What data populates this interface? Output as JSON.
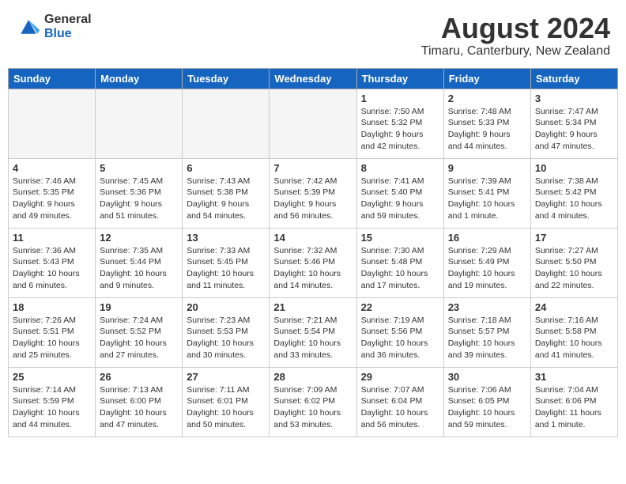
{
  "header": {
    "logo_general": "General",
    "logo_blue": "Blue",
    "title": "August 2024",
    "subtitle": "Timaru, Canterbury, New Zealand"
  },
  "days_of_week": [
    "Sunday",
    "Monday",
    "Tuesday",
    "Wednesday",
    "Thursday",
    "Friday",
    "Saturday"
  ],
  "weeks": [
    [
      {
        "day": "",
        "info": ""
      },
      {
        "day": "",
        "info": ""
      },
      {
        "day": "",
        "info": ""
      },
      {
        "day": "",
        "info": ""
      },
      {
        "day": "1",
        "info": "Sunrise: 7:50 AM\nSunset: 5:32 PM\nDaylight: 9 hours\nand 42 minutes."
      },
      {
        "day": "2",
        "info": "Sunrise: 7:48 AM\nSunset: 5:33 PM\nDaylight: 9 hours\nand 44 minutes."
      },
      {
        "day": "3",
        "info": "Sunrise: 7:47 AM\nSunset: 5:34 PM\nDaylight: 9 hours\nand 47 minutes."
      }
    ],
    [
      {
        "day": "4",
        "info": "Sunrise: 7:46 AM\nSunset: 5:35 PM\nDaylight: 9 hours\nand 49 minutes."
      },
      {
        "day": "5",
        "info": "Sunrise: 7:45 AM\nSunset: 5:36 PM\nDaylight: 9 hours\nand 51 minutes."
      },
      {
        "day": "6",
        "info": "Sunrise: 7:43 AM\nSunset: 5:38 PM\nDaylight: 9 hours\nand 54 minutes."
      },
      {
        "day": "7",
        "info": "Sunrise: 7:42 AM\nSunset: 5:39 PM\nDaylight: 9 hours\nand 56 minutes."
      },
      {
        "day": "8",
        "info": "Sunrise: 7:41 AM\nSunset: 5:40 PM\nDaylight: 9 hours\nand 59 minutes."
      },
      {
        "day": "9",
        "info": "Sunrise: 7:39 AM\nSunset: 5:41 PM\nDaylight: 10 hours\nand 1 minute."
      },
      {
        "day": "10",
        "info": "Sunrise: 7:38 AM\nSunset: 5:42 PM\nDaylight: 10 hours\nand 4 minutes."
      }
    ],
    [
      {
        "day": "11",
        "info": "Sunrise: 7:36 AM\nSunset: 5:43 PM\nDaylight: 10 hours\nand 6 minutes."
      },
      {
        "day": "12",
        "info": "Sunrise: 7:35 AM\nSunset: 5:44 PM\nDaylight: 10 hours\nand 9 minutes."
      },
      {
        "day": "13",
        "info": "Sunrise: 7:33 AM\nSunset: 5:45 PM\nDaylight: 10 hours\nand 11 minutes."
      },
      {
        "day": "14",
        "info": "Sunrise: 7:32 AM\nSunset: 5:46 PM\nDaylight: 10 hours\nand 14 minutes."
      },
      {
        "day": "15",
        "info": "Sunrise: 7:30 AM\nSunset: 5:48 PM\nDaylight: 10 hours\nand 17 minutes."
      },
      {
        "day": "16",
        "info": "Sunrise: 7:29 AM\nSunset: 5:49 PM\nDaylight: 10 hours\nand 19 minutes."
      },
      {
        "day": "17",
        "info": "Sunrise: 7:27 AM\nSunset: 5:50 PM\nDaylight: 10 hours\nand 22 minutes."
      }
    ],
    [
      {
        "day": "18",
        "info": "Sunrise: 7:26 AM\nSunset: 5:51 PM\nDaylight: 10 hours\nand 25 minutes."
      },
      {
        "day": "19",
        "info": "Sunrise: 7:24 AM\nSunset: 5:52 PM\nDaylight: 10 hours\nand 27 minutes."
      },
      {
        "day": "20",
        "info": "Sunrise: 7:23 AM\nSunset: 5:53 PM\nDaylight: 10 hours\nand 30 minutes."
      },
      {
        "day": "21",
        "info": "Sunrise: 7:21 AM\nSunset: 5:54 PM\nDaylight: 10 hours\nand 33 minutes."
      },
      {
        "day": "22",
        "info": "Sunrise: 7:19 AM\nSunset: 5:56 PM\nDaylight: 10 hours\nand 36 minutes."
      },
      {
        "day": "23",
        "info": "Sunrise: 7:18 AM\nSunset: 5:57 PM\nDaylight: 10 hours\nand 39 minutes."
      },
      {
        "day": "24",
        "info": "Sunrise: 7:16 AM\nSunset: 5:58 PM\nDaylight: 10 hours\nand 41 minutes."
      }
    ],
    [
      {
        "day": "25",
        "info": "Sunrise: 7:14 AM\nSunset: 5:59 PM\nDaylight: 10 hours\nand 44 minutes."
      },
      {
        "day": "26",
        "info": "Sunrise: 7:13 AM\nSunset: 6:00 PM\nDaylight: 10 hours\nand 47 minutes."
      },
      {
        "day": "27",
        "info": "Sunrise: 7:11 AM\nSunset: 6:01 PM\nDaylight: 10 hours\nand 50 minutes."
      },
      {
        "day": "28",
        "info": "Sunrise: 7:09 AM\nSunset: 6:02 PM\nDaylight: 10 hours\nand 53 minutes."
      },
      {
        "day": "29",
        "info": "Sunrise: 7:07 AM\nSunset: 6:04 PM\nDaylight: 10 hours\nand 56 minutes."
      },
      {
        "day": "30",
        "info": "Sunrise: 7:06 AM\nSunset: 6:05 PM\nDaylight: 10 hours\nand 59 minutes."
      },
      {
        "day": "31",
        "info": "Sunrise: 7:04 AM\nSunset: 6:06 PM\nDaylight: 11 hours\nand 1 minute."
      }
    ]
  ]
}
